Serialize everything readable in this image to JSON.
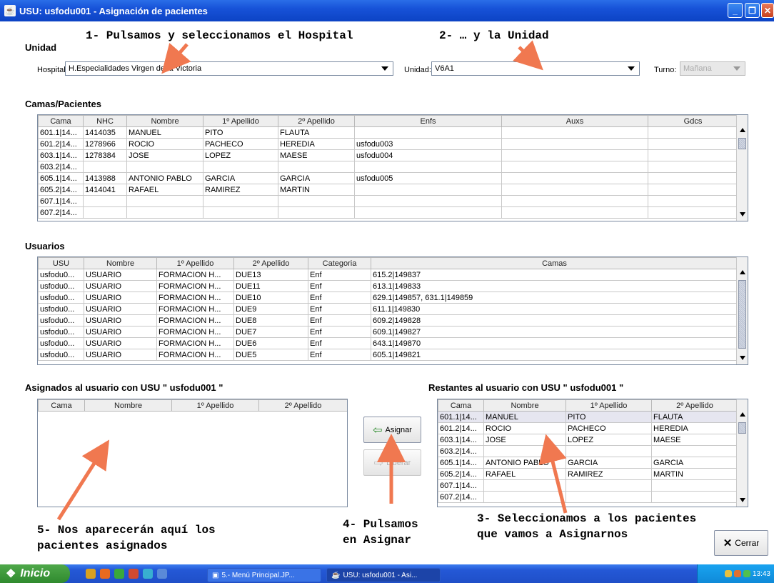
{
  "window": {
    "title": "USU: usfodu001 - Asignación de pacientes"
  },
  "annotations": {
    "step1": "1- Pulsamos y seleccionamos el Hospital",
    "step2": "2- … y la Unidad",
    "step3": "3- Seleccionamos a los pacientes\nque vamos a Asignarnos",
    "step4": "4- Pulsamos\nen Asignar",
    "step5": "5- Nos aparecerán aquí los\npacientes asignados"
  },
  "unidad": {
    "section_title": "Unidad",
    "hospital_label": "Hospital:",
    "hospital_value": "H.Especialidades Virgen de la Victoria",
    "unidad_label": "Unidad:",
    "unidad_value": "V6A1",
    "turno_label": "Turno:",
    "turno_value": "Mañana"
  },
  "camas": {
    "section_title": "Camas/Pacientes",
    "columns": [
      "Cama",
      "NHC",
      "Nombre",
      "1º Apellido",
      "2º Apellido",
      "Enfs",
      "Auxs",
      "Gdcs"
    ],
    "rows": [
      [
        "601.1|14...",
        "1414035",
        "MANUEL",
        "PITO",
        "FLAUTA",
        "",
        "",
        ""
      ],
      [
        "601.2|14...",
        "1278966",
        "ROCIO",
        "PACHECO",
        "HEREDIA",
        "usfodu003",
        "",
        ""
      ],
      [
        "603.1|14...",
        "1278384",
        "JOSE",
        "LOPEZ",
        "MAESE",
        "usfodu004",
        "",
        ""
      ],
      [
        "603.2|14...",
        "",
        "",
        "",
        "",
        "",
        "",
        ""
      ],
      [
        "605.1|14...",
        "1413988",
        "ANTONIO PABLO",
        "GARCIA",
        "GARCIA",
        "usfodu005",
        "",
        ""
      ],
      [
        "605.2|14...",
        "1414041",
        "RAFAEL",
        "RAMIREZ",
        "MARTIN",
        "",
        "",
        ""
      ],
      [
        "607.1|14...",
        "",
        "",
        "",
        "",
        "",
        "",
        ""
      ],
      [
        "607.2|14...",
        "",
        "",
        "",
        "",
        "",
        "",
        ""
      ]
    ]
  },
  "usuarios": {
    "section_title": "Usuarios",
    "columns": [
      "USU",
      "Nombre",
      "1º Apellido",
      "2º Apellido",
      "Categoria",
      "Camas"
    ],
    "rows": [
      [
        "usfodu0...",
        "USUARIO",
        "FORMACION H...",
        "DUE13",
        "Enf",
        "615.2|149837"
      ],
      [
        "usfodu0...",
        "USUARIO",
        "FORMACION H...",
        "DUE11",
        "Enf",
        "613.1|149833"
      ],
      [
        "usfodu0...",
        "USUARIO",
        "FORMACION H...",
        "DUE10",
        "Enf",
        "629.1|149857, 631.1|149859"
      ],
      [
        "usfodu0...",
        "USUARIO",
        "FORMACION H...",
        "DUE9",
        "Enf",
        "611.1|149830"
      ],
      [
        "usfodu0...",
        "USUARIO",
        "FORMACION H...",
        "DUE8",
        "Enf",
        "609.2|149828"
      ],
      [
        "usfodu0...",
        "USUARIO",
        "FORMACION H...",
        "DUE7",
        "Enf",
        "609.1|149827"
      ],
      [
        "usfodu0...",
        "USUARIO",
        "FORMACION H...",
        "DUE6",
        "Enf",
        "643.1|149870"
      ],
      [
        "usfodu0...",
        "USUARIO",
        "FORMACION H...",
        "DUE5",
        "Enf",
        "605.1|149821"
      ]
    ]
  },
  "asignados": {
    "section_title": "Asignados al usuario con USU \" usfodu001 \"",
    "columns": [
      "Cama",
      "Nombre",
      "1º Apellido",
      "2º Apellido"
    ],
    "rows": []
  },
  "restantes": {
    "section_title": "Restantes al usuario con USU \" usfodu001 \"",
    "columns": [
      "Cama",
      "Nombre",
      "1º Apellido",
      "2º Apellido"
    ],
    "rows": [
      [
        "601.1|14...",
        "MANUEL",
        "PITO",
        "FLAUTA"
      ],
      [
        "601.2|14...",
        "ROCIO",
        "PACHECO",
        "HEREDIA"
      ],
      [
        "603.1|14...",
        "JOSE",
        "LOPEZ",
        "MAESE"
      ],
      [
        "603.2|14...",
        "",
        "",
        ""
      ],
      [
        "605.1|14...",
        "ANTONIO PABLO",
        "GARCIA",
        "GARCIA"
      ],
      [
        "605.2|14...",
        "RAFAEL",
        "RAMIREZ",
        "MARTIN"
      ],
      [
        "607.1|14...",
        "",
        "",
        ""
      ],
      [
        "607.2|14...",
        "",
        "",
        ""
      ]
    ]
  },
  "buttons": {
    "asignar": "Asignar",
    "liberar": "Liberar",
    "cerrar": "Cerrar"
  },
  "taskbar": {
    "start": "Inicio",
    "task1": "5.- Menú Principal.JP...",
    "task2": "USU: usfodu001 - Asi...",
    "clock": "13:43"
  },
  "colors": {
    "annotation_arrow": "#f07850",
    "title_bar": "#0c43c4",
    "taskbar": "#2458d6"
  }
}
